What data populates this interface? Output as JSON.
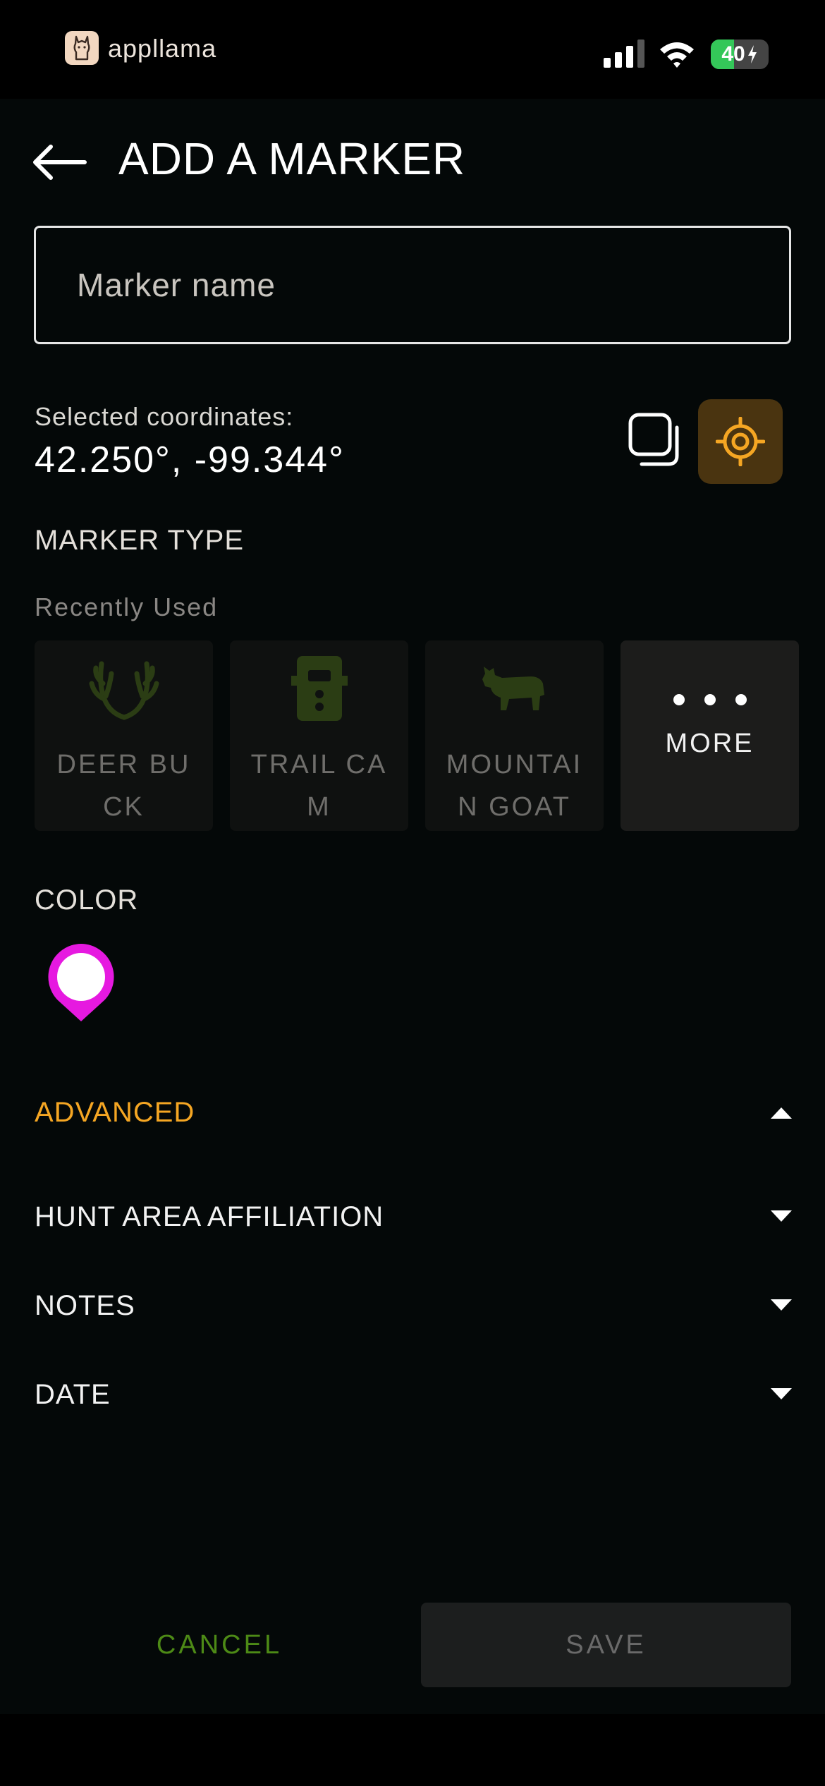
{
  "status_bar": {
    "app_name": "appllama",
    "battery_percent": "40",
    "battery_level": 0.4,
    "icons": [
      "signal-icon",
      "wifi-icon",
      "battery-icon",
      "charging-icon"
    ]
  },
  "header": {
    "title": "ADD A MARKER",
    "back_icon": "arrow-left-icon"
  },
  "name_field": {
    "placeholder": "Marker name",
    "value": ""
  },
  "coordinates": {
    "label": "Selected coordinates:",
    "value": "42.250°, -99.344°",
    "copy_icon": "copy-icon",
    "locate_icon": "crosshair-icon"
  },
  "marker_type": {
    "section_label": "MARKER TYPE",
    "recent_label": "Recently Used",
    "items": [
      {
        "label": "DEER BUCK",
        "icon": "antlers-icon"
      },
      {
        "label": "TRAIL CAM",
        "icon": "trail-camera-icon"
      },
      {
        "label": "MOUNTAIN GOAT",
        "icon": "mountain-goat-icon"
      },
      {
        "label": "MORE",
        "icon": "more-dots-icon"
      }
    ]
  },
  "color": {
    "section_label": "COLOR",
    "selected": "#e619e0"
  },
  "sections": {
    "advanced": "ADVANCED",
    "hunt_area": "HUNT AREA AFFILIATION",
    "notes": "NOTES",
    "date": "DATE"
  },
  "actions": {
    "cancel": "CANCEL",
    "save": "SAVE"
  },
  "colors": {
    "accent_orange": "#f5a623",
    "cancel_green": "#4d8a16",
    "icon_dim_green": "#2b3d14",
    "pin_magenta": "#e619e0"
  }
}
